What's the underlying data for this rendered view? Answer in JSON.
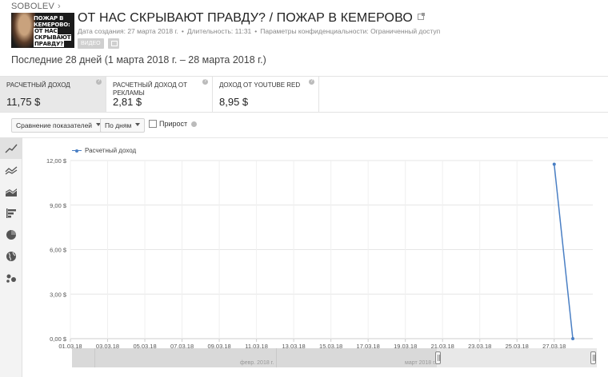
{
  "breadcrumb": {
    "channel": "SOBOLEV",
    "arrow": "›"
  },
  "video": {
    "thumb_lines": [
      "ПОЖАР В",
      "КЕМЕРОВО:",
      "ОТ НАС",
      "СКРЫВАЮТ",
      "ПРАВДУ?"
    ],
    "title": "ОТ НАС СКРЫВАЮТ ПРАВДУ? / ПОЖАР В КЕМЕРОВО",
    "created": "Дата создания: 27 марта 2018 г.",
    "duration": "Длительность: 11:31",
    "privacy": "Параметры конфиденциальности: Ограниченный доступ",
    "badge_video": "ВИДЕО",
    "badge_icon": "computer-icon"
  },
  "date_range": "Последние 28 дней (1 марта 2018 г. – 28 марта 2018 г.)",
  "cards": [
    {
      "label": "РАСЧЕТНЫЙ ДОХОД",
      "value": "11,75 $",
      "active": true
    },
    {
      "label": "РАСЧЕТНЫЙ ДОХОД ОТ РЕКЛАМЫ",
      "value": "2,81 $",
      "active": false
    },
    {
      "label": "ДОХОД ОТ YOUTUBE RED",
      "value": "8,95 $",
      "active": false
    }
  ],
  "controls": {
    "compare": "Сравнение показателей",
    "period": "По дням",
    "growth": "Прирост"
  },
  "sidebar_icons": [
    "line-chart-icon",
    "multi-line-chart-icon",
    "area-chart-icon",
    "bar-chart-icon",
    "pie-chart-icon",
    "globe-map-icon",
    "bubble-chart-icon"
  ],
  "chart_data": {
    "type": "line",
    "series": [
      {
        "name": "Расчетный доход",
        "color": "#4a7fc4",
        "x": [
          "27.03.18",
          "28.03.18"
        ],
        "values": [
          11.75,
          0
        ]
      }
    ],
    "x_ticks": [
      "01.03.18",
      "03.03.18",
      "05.03.18",
      "07.03.18",
      "09.03.18",
      "11.03.18",
      "13.03.18",
      "15.03.18",
      "17.03.18",
      "19.03.18",
      "21.03.18",
      "23.03.18",
      "25.03.18",
      "27.03.18"
    ],
    "y_ticks": [
      "0,00 $",
      "3,00 $",
      "6,00 $",
      "9,00 $",
      "12,00 $"
    ],
    "ylim": [
      0,
      12
    ],
    "grid": true,
    "legend": "top-left"
  },
  "navigator": {
    "months": [
      "февр. 2018 г.",
      "март 2018 г."
    ]
  }
}
